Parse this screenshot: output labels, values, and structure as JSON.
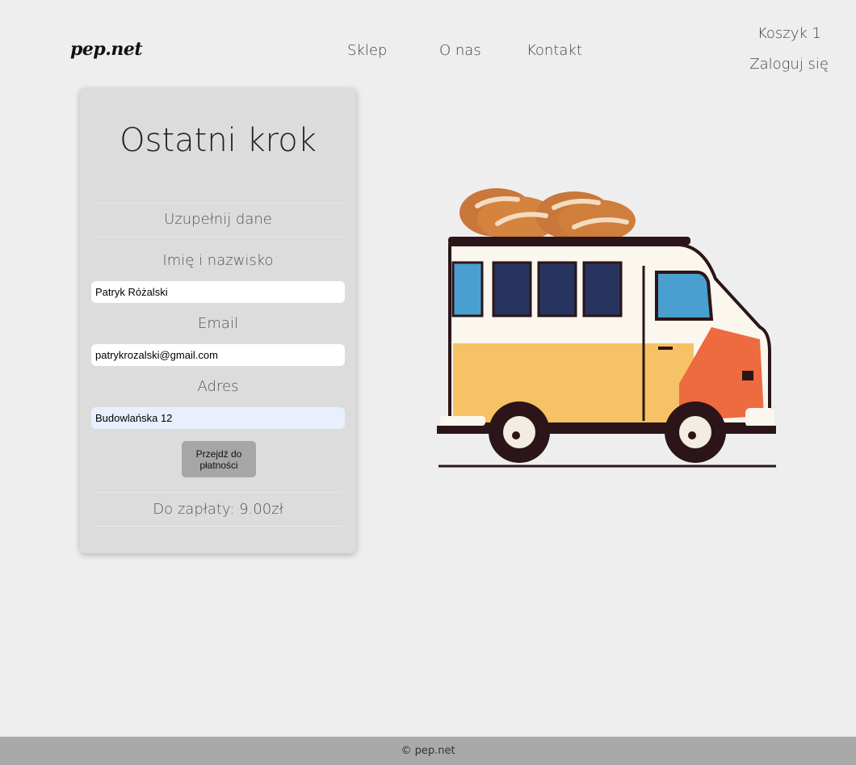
{
  "header": {
    "logo": "pep.net",
    "nav": {
      "shop": "Sklep",
      "about": "O nas",
      "contact": "Kontakt"
    },
    "cart_label": "Koszyk 1",
    "login_label": "Zaloguj się"
  },
  "card": {
    "title": "Ostatni krok",
    "section_label": "Uzupełnij dane",
    "name_label": "Imię i nazwisko",
    "name_value": "Patryk Różalski",
    "email_label": "Email",
    "email_value": "patrykrozalski@gmail.com",
    "address_label": "Adres",
    "address_value": "Budowlańska 12",
    "pay_button": "Przejdź do płatności",
    "total_label": "Do zapłaty:",
    "total_value": "9.00zł"
  },
  "illustration": {
    "icon": "bread-van-illustration"
  },
  "footer": {
    "copyright": "© pep.net"
  },
  "colors": {
    "background": "#eeeeee",
    "card": "#dcdcdc",
    "button": "#a6a6a6",
    "footer": "#a9a9a9",
    "autofill": "#e8f0fe"
  }
}
